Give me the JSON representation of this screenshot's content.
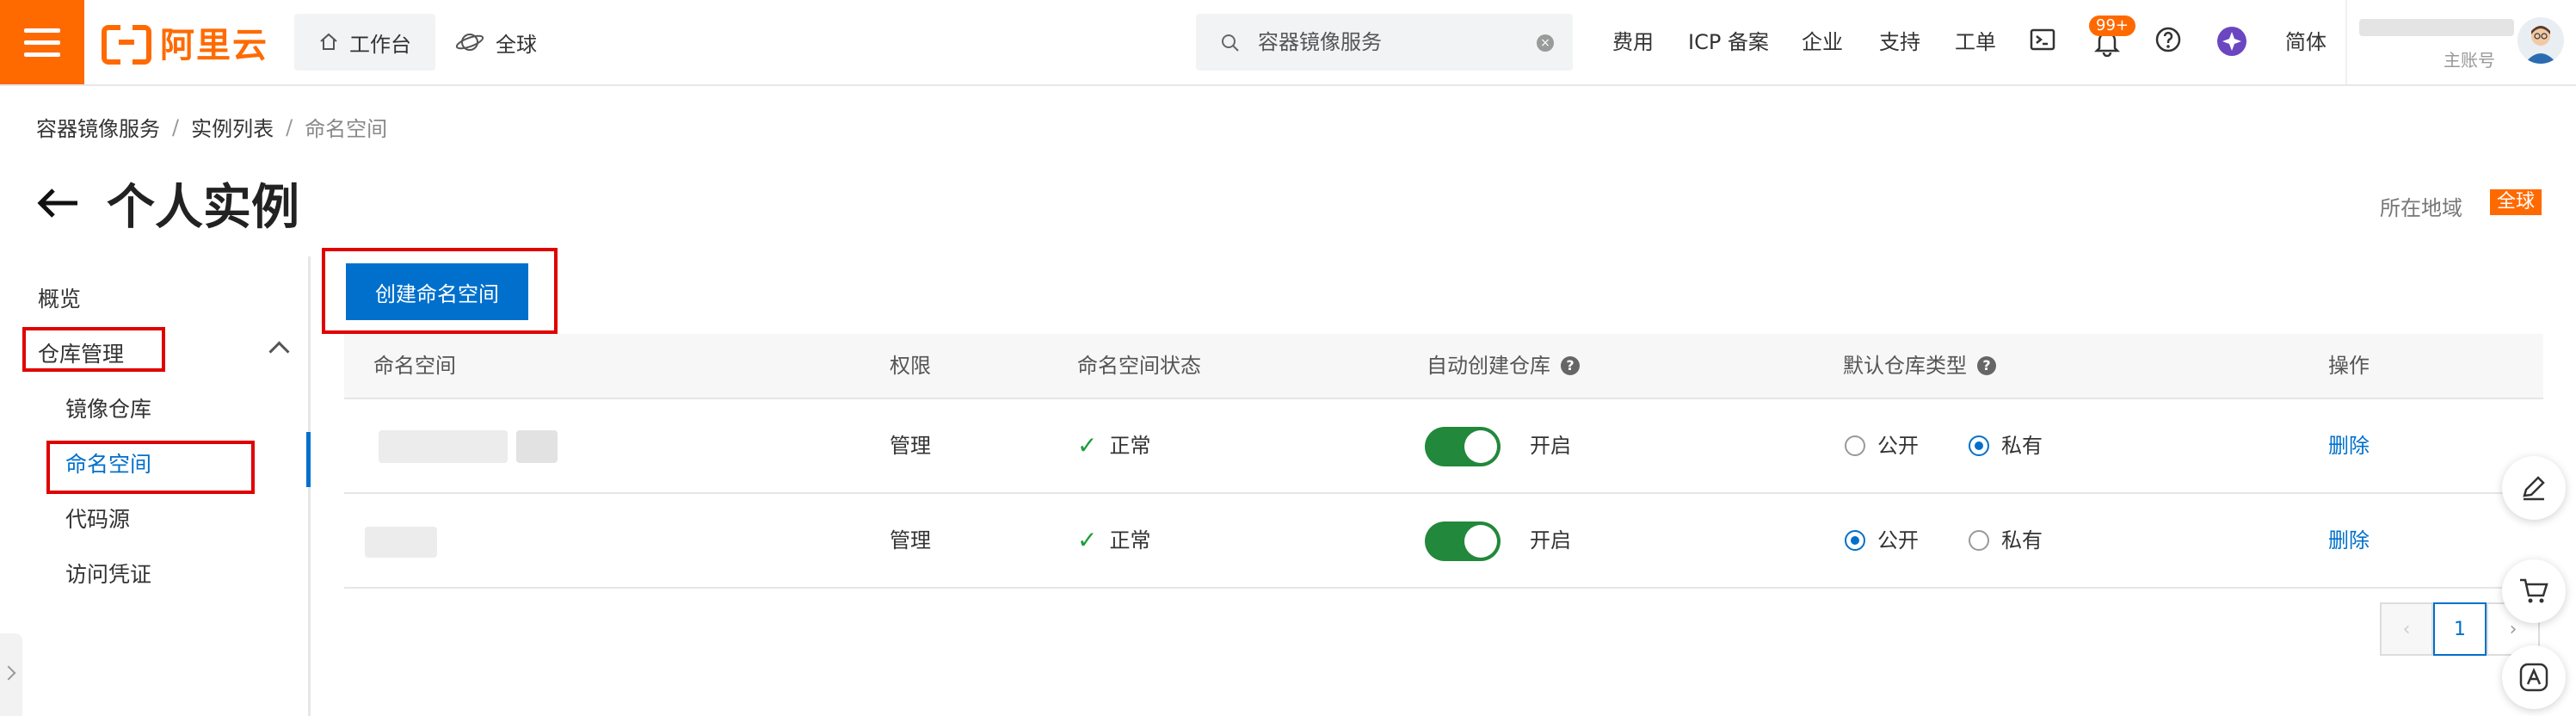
{
  "topbar": {
    "logo_text": "阿里云",
    "workspace_label": "工作台",
    "global_label": "全球",
    "search_placeholder": "容器镜像服务",
    "links": [
      "费用",
      "ICP 备案",
      "企业",
      "支持",
      "工单"
    ],
    "notification_badge": "99+",
    "lang_label": "简体",
    "account_type": "主账号"
  },
  "breadcrumb": {
    "items": [
      "容器镜像服务",
      "实例列表",
      "命名空间"
    ],
    "separator": "/"
  },
  "page": {
    "title": "个人实例",
    "region_label": "所在地域",
    "region_value": "全球"
  },
  "sidebar": {
    "items": [
      {
        "label": "概览"
      },
      {
        "label": "仓库管理"
      },
      {
        "label": "镜像仓库"
      },
      {
        "label": "命名空间"
      },
      {
        "label": "代码源"
      },
      {
        "label": "访问凭证"
      }
    ]
  },
  "main": {
    "create_button": "创建命名空间",
    "columns": [
      "命名空间",
      "权限",
      "命名空间状态",
      "自动创建仓库",
      "默认仓库类型",
      "操作"
    ],
    "rows": [
      {
        "permission": "管理",
        "status": "正常",
        "auto_create": "开启",
        "public_label": "公开",
        "private_label": "私有",
        "default_type": "私有",
        "action": "删除"
      },
      {
        "permission": "管理",
        "status": "正常",
        "auto_create": "开启",
        "public_label": "公开",
        "private_label": "私有",
        "default_type": "公开",
        "action": "删除"
      }
    ],
    "pagination": {
      "current": "1"
    }
  },
  "colors": {
    "brand": "#ff6a00",
    "primary": "#0070cc",
    "toggle_on": "#22883b",
    "annotation_red": "#e00000"
  },
  "icons": [
    "menu-icon",
    "home-icon",
    "globe-icon",
    "search-icon",
    "clear-icon",
    "terminal-icon",
    "bell-icon",
    "help-icon",
    "app-icon",
    "back-arrow-icon",
    "chevron-up-icon",
    "check-icon",
    "edit-icon",
    "cart-icon",
    "app-download-icon"
  ]
}
